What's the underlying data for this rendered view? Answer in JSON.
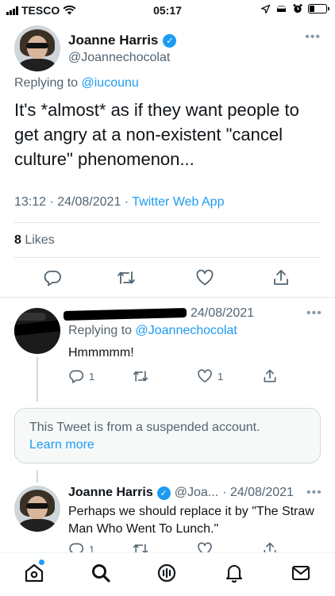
{
  "status_bar": {
    "carrier": "TESCO",
    "time": "05:17"
  },
  "main_tweet": {
    "author_name": "Joanne Harris",
    "author_handle": "@Joannechocolat",
    "replying_prefix": "Replying to ",
    "replying_to": "@iucounu",
    "text": "It's *almost* as if they want people to get angry at a non-existent \"cancel culture\" phenomenon...",
    "timestamp": "13:12 · 24/08/2021 · ",
    "source_app": "Twitter Web App",
    "likes_count": "8",
    "likes_label": " Likes"
  },
  "reply_1": {
    "date": "24/08/2021",
    "replying_prefix": "Replying to ",
    "replying_to": "@Joannechocolat",
    "text": "Hmmmmm!",
    "reply_count": "1",
    "like_count": "1"
  },
  "suspended": {
    "message": "This Tweet is from a suspended account.",
    "learn_more": "Learn more"
  },
  "reply_2": {
    "author_name": "Joanne Harris",
    "author_handle": "@Joa...",
    "date": "· 24/08/2021",
    "text": "Perhaps we should replace it by \"The Straw Man Who Went To Lunch.\"",
    "reply_count": "1"
  },
  "icons": {
    "more": "more-icon",
    "reply": "reply-icon",
    "retweet": "retweet-icon",
    "like": "heart-icon",
    "share": "share-icon",
    "nav": [
      "home-icon",
      "search-icon",
      "spaces-icon",
      "notifications-icon",
      "messages-icon"
    ]
  },
  "colors": {
    "accent": "#1d9bf0",
    "secondary_text": "#536471"
  }
}
